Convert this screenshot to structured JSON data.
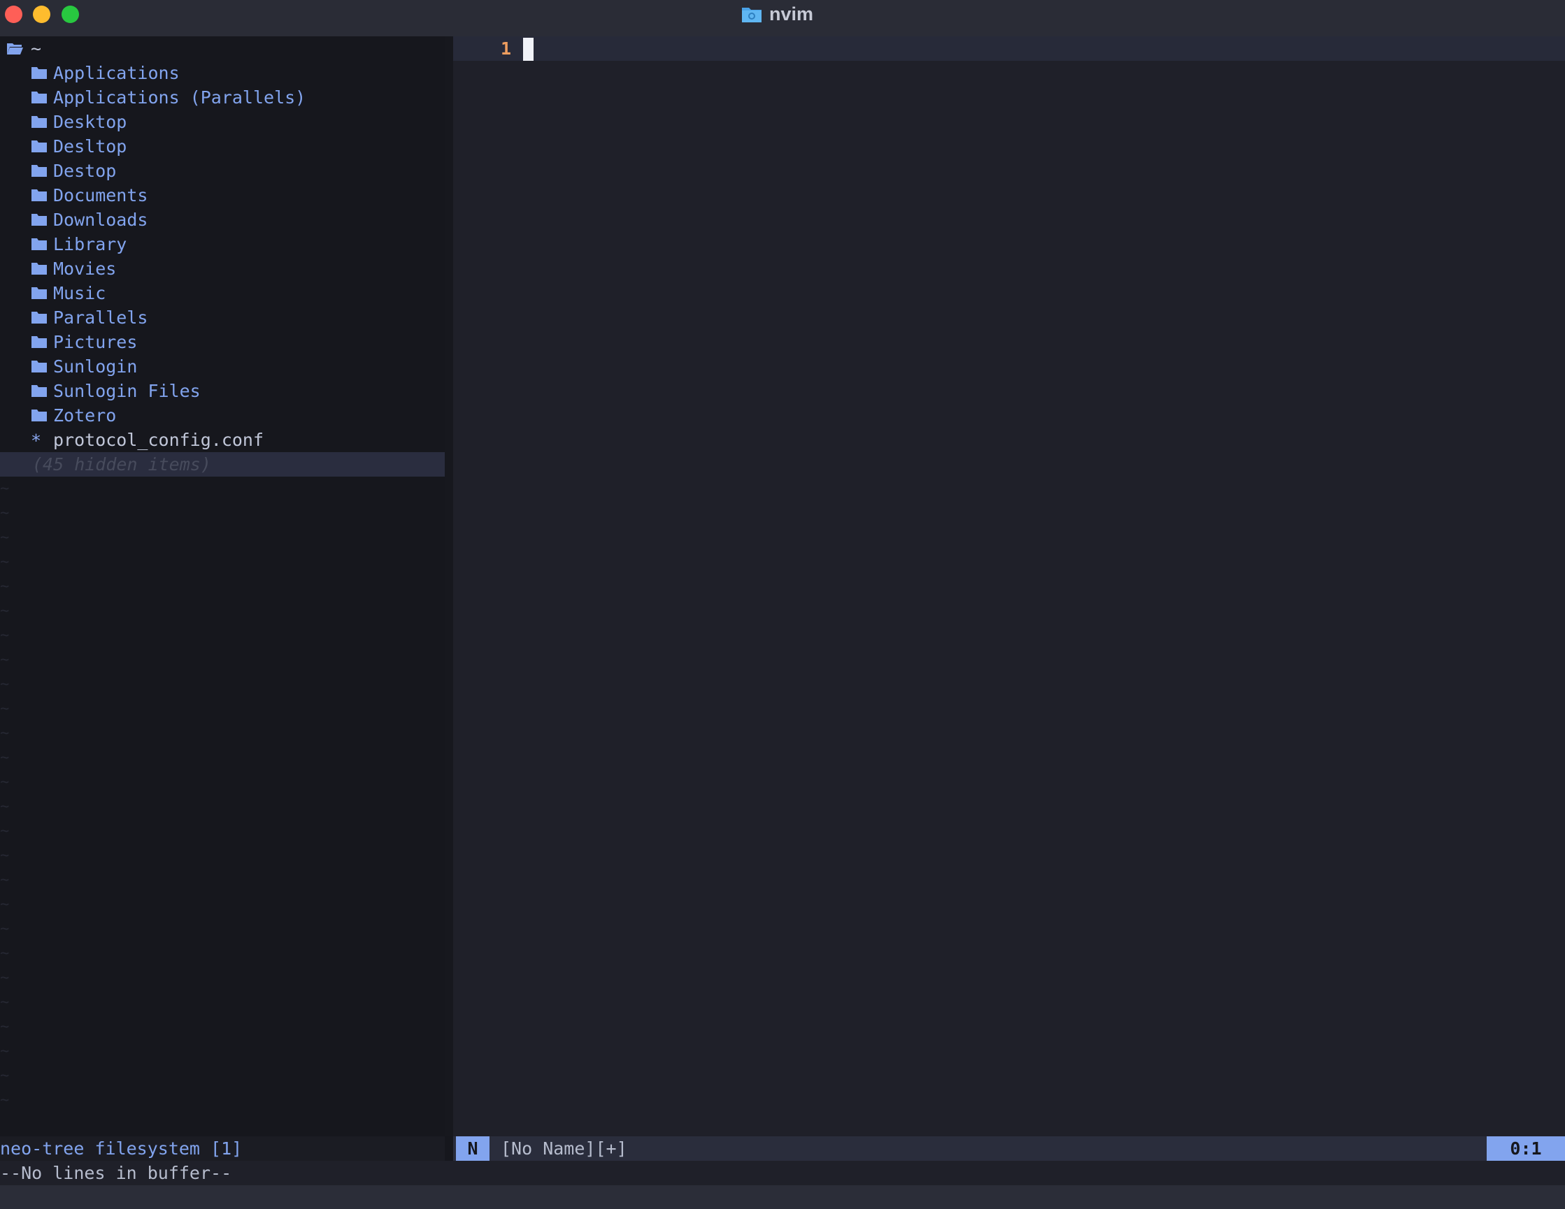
{
  "window": {
    "title": "nvim",
    "controls": [
      "close",
      "minimize",
      "zoom"
    ]
  },
  "tree": {
    "root": "~",
    "folders": [
      "Applications",
      "Applications (Parallels)",
      "Desktop",
      "Desltop",
      "Destop",
      "Documents",
      "Downloads",
      "Library",
      "Movies",
      "Music",
      "Parallels",
      "Pictures",
      "Sunlogin",
      "Sunlogin Files",
      "Zotero"
    ],
    "file": {
      "marker": "*",
      "name": "protocol_config.conf"
    },
    "hidden_note": "(45 hidden items)"
  },
  "editor": {
    "line_number": "1"
  },
  "statusline": {
    "tree_label": "neo-tree filesystem [1]",
    "mode": "N",
    "buffer": "[No Name][+]",
    "position": "0:1"
  },
  "cmdline": {
    "message": "--No lines in buffer--"
  },
  "colors": {
    "folder": "#82a4ee",
    "accent": "#82a4ee",
    "line_number": "#ee9d5f",
    "tree_bg": "#16171d",
    "editor_bg": "#1f2029"
  }
}
